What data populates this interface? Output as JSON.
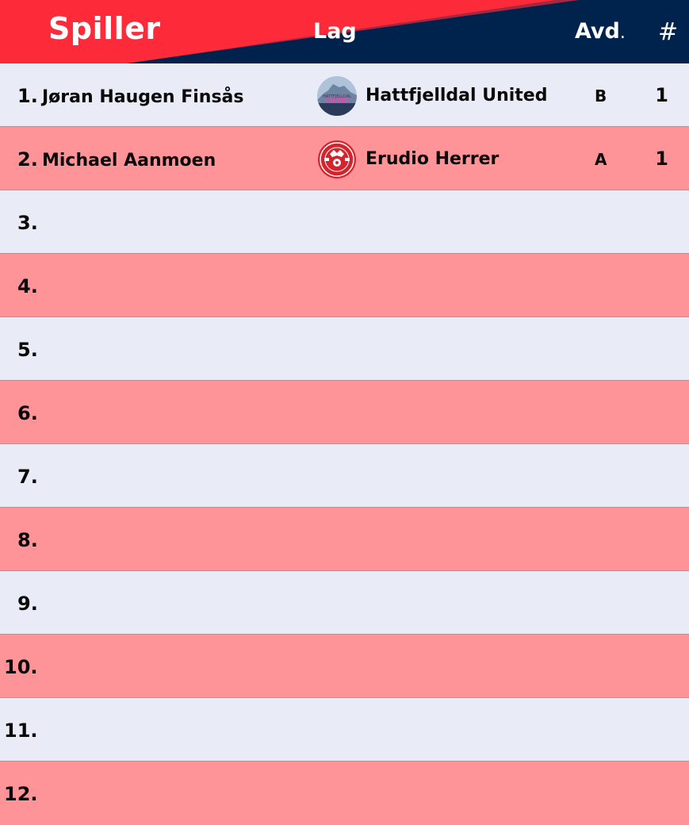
{
  "header": {
    "player_label": "Spiller",
    "team_label": "Lag",
    "division_label": "Avd",
    "division_suffix": ".",
    "count_label": "#",
    "colors": {
      "red": "#fd2b39",
      "navy": "#00234d"
    }
  },
  "rows": [
    {
      "rank": "1.",
      "player": "Jøran Haugen Finsås",
      "team": "Hattfjelldal United",
      "logo": "hattfjelldal-united-logo",
      "logo_text": [
        "HATTFJELLDAL",
        "UNITED"
      ],
      "division": "B",
      "count": "1"
    },
    {
      "rank": "2.",
      "player": "Michael Aanmoen",
      "team": "Erudio Herrer",
      "logo": "erudio-herrer-logo",
      "division": "A",
      "count": "1"
    },
    {
      "rank": "3."
    },
    {
      "rank": "4."
    },
    {
      "rank": "5."
    },
    {
      "rank": "6."
    },
    {
      "rank": "7."
    },
    {
      "rank": "8."
    },
    {
      "rank": "9."
    },
    {
      "rank": "10."
    },
    {
      "rank": "11."
    },
    {
      "rank": "12."
    }
  ],
  "colors": {
    "row_light": "#e9ebf6",
    "row_dark": "#fe9398",
    "divider": "#8f97d6"
  }
}
